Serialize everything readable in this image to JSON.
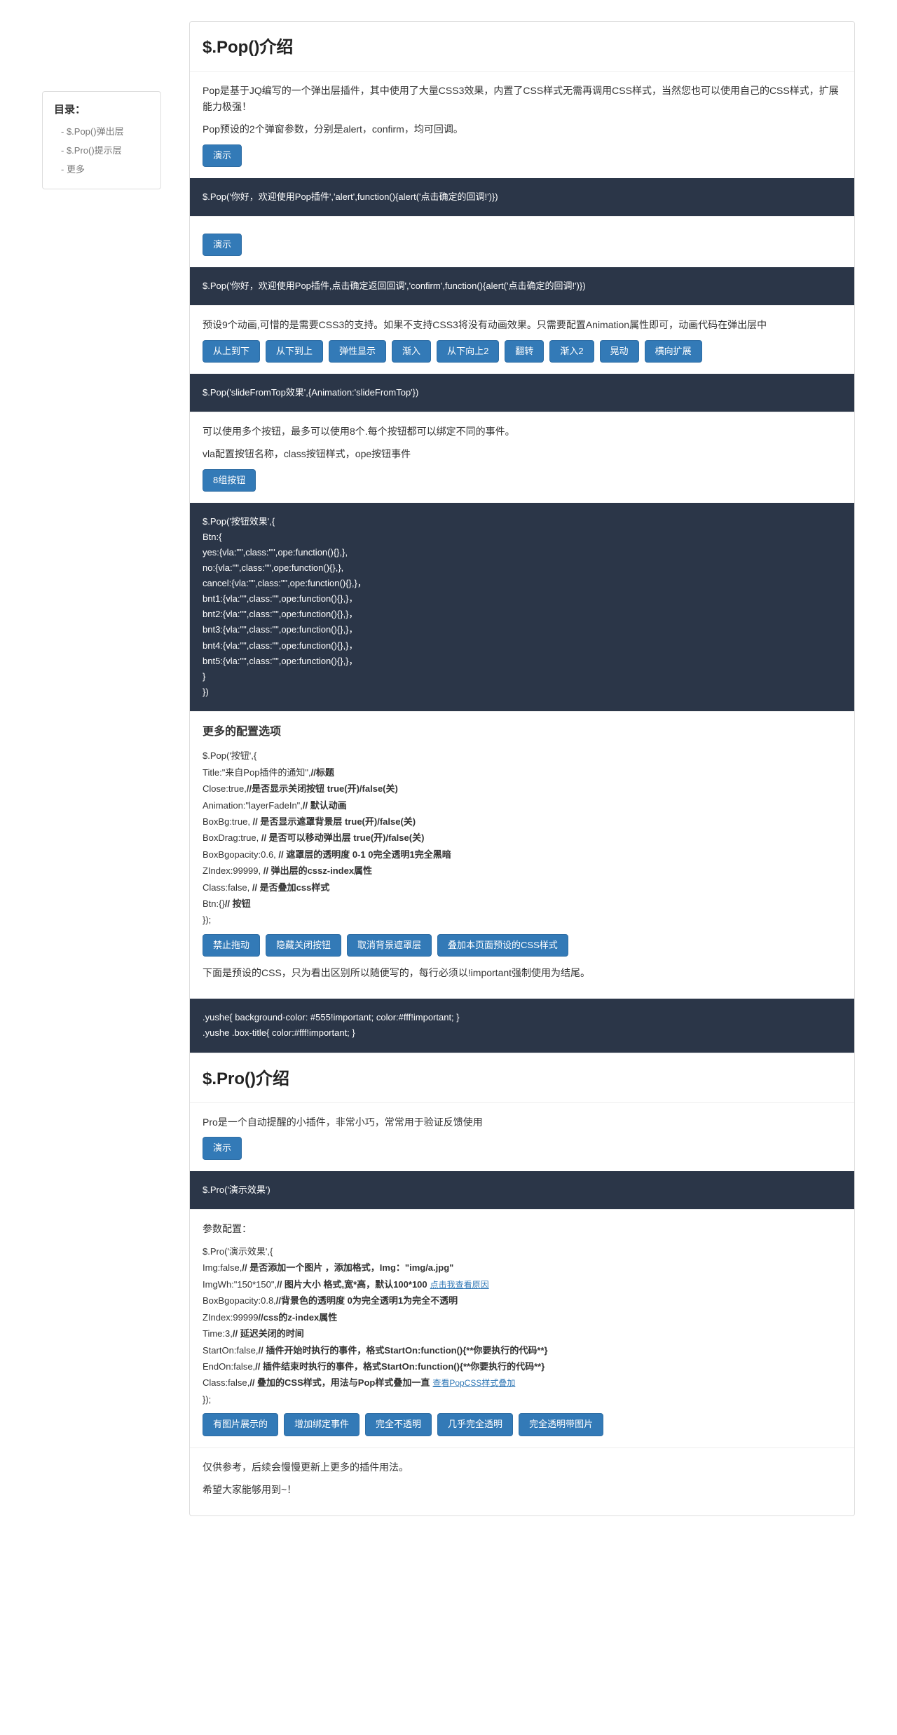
{
  "toc": {
    "title": "目录：",
    "items": [
      "- $.Pop()弹出层",
      "- $.Pro()提示层",
      "- 更多"
    ]
  },
  "pop": {
    "heading": "$.Pop()介绍",
    "intro1": "Pop是基于JQ编写的一个弹出层插件，其中使用了大量CSS3效果，内置了CSS样式无需再调用CSS样式，当然您也可以使用自己的CSS样式，扩展能力极强！",
    "intro2": "Pop预设的2个弹窗参数，分别是alert，confirm，均可回调。",
    "demo_label": "演示",
    "code1": "$.Pop('你好，欢迎使用Pop插件','alert',function(){alert('点击确定的回调!')})",
    "code2": "$.Pop('你好，欢迎使用Pop插件,点击确定返回回调','confirm',function(){alert('点击确定的回调!')})",
    "anim_intro": "预设9个动画,可惜的是需要CSS3的支持。如果不支持CSS3将没有动画效果。只需要配置Animation属性即可，动画代码在弹出层中",
    "anim_buttons": [
      "从上到下",
      "从下到上",
      "弹性显示",
      "渐入",
      "从下向上2",
      "翻转",
      "渐入2",
      "晃动",
      "横向扩展"
    ],
    "code3": "$.Pop('slideFromTop效果',{Animation:'slideFromTop'})",
    "multi_btn_intro1": "可以使用多个按钮，最多可以使用8个.每个按钮都可以绑定不同的事件。",
    "multi_btn_intro2": "vla配置按钮名称，class按钮样式，ope按钮事件",
    "eight_btn_label": "8组按钮",
    "code4": "$.Pop('按钮效果',{\nBtn:{\nyes:{vla:\"\",class:\"\",ope:function(){},},\nno:{vla:\"\",class:\"\",ope:function(){},},\ncancel:{vla:\"\",class:\"\",ope:function(){},}，\nbnt1:{vla:\"\",class:\"\",ope:function(){},}，\nbnt2:{vla:\"\",class:\"\",ope:function(){},}，\nbnt3:{vla:\"\",class:\"\",ope:function(){},}，\nbnt4:{vla:\"\",class:\"\",ope:function(){},}，\nbnt5:{vla:\"\",class:\"\",ope:function(){},}，\n}\n})",
    "more_cfg_heading": "更多的配置选项",
    "more_cfg_lines": [
      {
        "plain": "$.Pop('按钮',{"
      },
      {
        "plain": "Title:\"来自Pop插件的通知\",",
        "bold": "//标题"
      },
      {
        "plain": "Close:true,",
        "bold": "//是否显示关闭按钮 true(开)/false(关)"
      },
      {
        "plain": "Animation:\"layerFadeIn\",",
        "bold": "// 默认动画"
      },
      {
        "plain": "BoxBg:true, ",
        "bold": "// 是否显示遮罩背景层 true(开)/false(关)"
      },
      {
        "plain": "BoxDrag:true, ",
        "bold": "// 是否可以移动弹出层 true(开)/false(关)"
      },
      {
        "plain": "BoxBgopacity:0.6, ",
        "bold": "// 遮罩层的透明度 0-1 0完全透明1完全黑暗"
      },
      {
        "plain": "ZIndex:99999, ",
        "bold": "// 弹出层的cssz-index属性"
      },
      {
        "plain": "Class:false, ",
        "bold": "// 是否叠加css样式"
      },
      {
        "plain": "Btn:{}",
        "bold": "// 按钮"
      },
      {
        "plain": "});"
      }
    ],
    "more_cfg_buttons": [
      "禁止拖动",
      "隐藏关闭按钮",
      "取消背景遮罩层",
      "叠加本页面预设的CSS样式"
    ],
    "preset_css_note": "下面是预设的CSS，只为看出区别所以随便写的，每行必须以!important强制使用为结尾。",
    "code5": ".yushe{ background-color: #555!important; color:#fff!important; }\n.yushe .box-title{ color:#fff!important; }"
  },
  "pro": {
    "heading": "$.Pro()介绍",
    "intro": "Pro是一个自动提醒的小插件，非常小巧，常常用于验证反馈使用",
    "demo_label": "演示",
    "code1": "$.Pro('演示效果')",
    "cfg_title": "参数配置：",
    "cfg_lines": [
      {
        "plain": "$.Pro('演示效果',{"
      },
      {
        "plain": "Img:false,",
        "bold": "// 是否添加一个图片 ，添加格式，Img：\"img/a.jpg\""
      },
      {
        "plain": "ImgWh:\"150*150\",",
        "bold": "// 图片大小 格式,宽*高，默认100*100",
        "link": "点击我查看原因"
      },
      {
        "plain": "BoxBgopacity:0.8,",
        "bold": "//背景色的透明度 0为完全透明1为完全不透明"
      },
      {
        "plain": "ZIndex:99999",
        "bold": "//css的z-index属性"
      },
      {
        "plain": "Time:3,",
        "bold": "// 延迟关闭的时间"
      },
      {
        "plain": "StartOn:false,",
        "bold": "// 插件开始时执行的事件，格式StartOn:function(){**你要执行的代码**}"
      },
      {
        "plain": "EndOn:false,",
        "bold": "// 插件结束时执行的事件，格式StartOn:function(){**你要执行的代码**}"
      },
      {
        "plain": "Class:false,",
        "bold": "// 叠加的CSS样式，用法与Pop样式叠加一直",
        "link": "查看PopCSS样式叠加"
      },
      {
        "plain": "});"
      }
    ],
    "buttons": [
      "有图片展示的",
      "增加绑定事件",
      "完全不透明",
      "几乎完全透明",
      "完全透明带图片"
    ]
  },
  "footer": {
    "line1": "仅供参考，后续会慢慢更新上更多的插件用法。",
    "line2": "希望大家能够用到~！"
  }
}
